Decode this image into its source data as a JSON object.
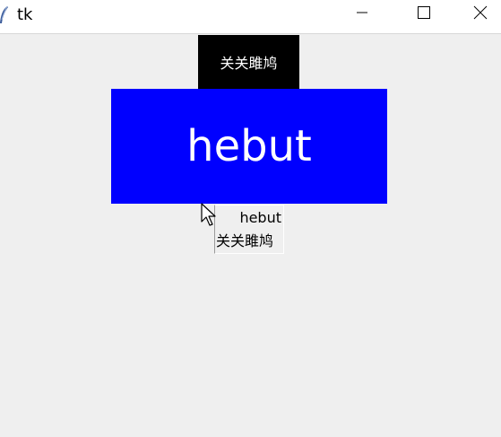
{
  "window": {
    "title": "tk",
    "controls": {
      "minimize": "minimize-icon",
      "maximize": "maximize-icon",
      "close": "close-icon"
    }
  },
  "label": {
    "text": "关关雎鸠",
    "background": "#000000",
    "foreground": "#ffffff"
  },
  "button": {
    "text": "hebut",
    "background": "#0000ff",
    "foreground": "#ffffff"
  },
  "textbox": {
    "line1": "hebut",
    "line2": "关关雎鸠"
  },
  "colors": {
    "window_bg": "#efefef",
    "titlebar_bg": "#ffffff"
  }
}
